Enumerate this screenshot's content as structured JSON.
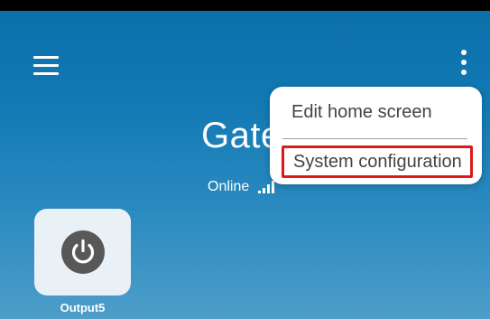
{
  "header": {
    "menu_icon": "hamburger-menu-icon",
    "overflow_icon": "more-vertical-icon"
  },
  "device": {
    "title": "Gate",
    "status": "Online",
    "signal_icon": "signal-strength-icon"
  },
  "tiles": [
    {
      "label": "Output5",
      "icon": "power-icon"
    }
  ],
  "overflow_menu": {
    "items": [
      {
        "label": "Edit home screen"
      },
      {
        "label": "System configuration",
        "highlighted": true
      }
    ],
    "highlight_color": "#dd1a1a"
  },
  "colors": {
    "background_top": "#0b6fa9",
    "background_bottom": "#4d9ec9",
    "tile_background": "#e9f1f7",
    "power_button": "#585858"
  }
}
